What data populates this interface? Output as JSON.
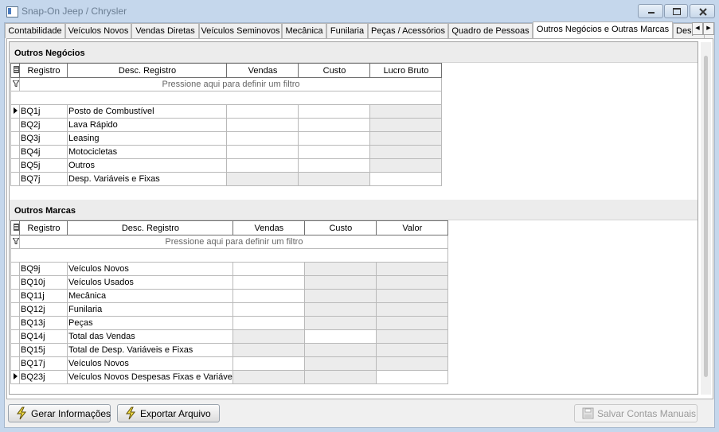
{
  "window": {
    "title": "Snap-On Jeep / Chrysler"
  },
  "tabs": [
    {
      "label": "Contabilidade"
    },
    {
      "label": "Veículos Novos"
    },
    {
      "label": "Vendas Diretas"
    },
    {
      "label": "Veículos Seminovos"
    },
    {
      "label": "Mecânica"
    },
    {
      "label": "Funilaria"
    },
    {
      "label": "Peças / Acessórios"
    },
    {
      "label": "Quadro de Pessoas"
    },
    {
      "label": "Outros Negócios e Outras Marcas",
      "active": true
    },
    {
      "label": "Desp"
    }
  ],
  "icons": {
    "tab_scroll_left": "chevron-left-icon",
    "tab_scroll_right": "chevron-right-icon",
    "row_indicator": "row-pointer-icon",
    "column_chooser": "column-chooser-icon",
    "filter": "funnel-icon",
    "action": "lightning-icon",
    "save": "save-icon"
  },
  "colors": {
    "title_text": "#6b7e93",
    "filter_hint": "#666666",
    "readonly_cell": "#ececec"
  },
  "section1": {
    "title": "Outros Negócios",
    "columns": [
      "Registro",
      "Desc. Registro",
      "Vendas",
      "Custo",
      "Lucro Bruto"
    ],
    "filter_hint": "Pressione aqui para definir um filtro",
    "rows": [
      {
        "registro": "BQ1j",
        "desc": "Posto de Combustível",
        "current": true
      },
      {
        "registro": "BQ2j",
        "desc": "Lava Rápido"
      },
      {
        "registro": "BQ3j",
        "desc": "Leasing"
      },
      {
        "registro": "BQ4j",
        "desc": "Motocicletas"
      },
      {
        "registro": "BQ5j",
        "desc": "Outros"
      },
      {
        "registro": "BQ7j",
        "desc": "Desp. Variáveis e Fixas"
      }
    ]
  },
  "section2": {
    "title": "Outros Marcas",
    "columns": [
      "Registro",
      "Desc. Registro",
      "Vendas",
      "Custo",
      "Valor"
    ],
    "filter_hint": "Pressione aqui para definir um filtro",
    "rows": [
      {
        "registro": "BQ9j",
        "desc": "Veículos Novos"
      },
      {
        "registro": "BQ10j",
        "desc": "Veículos Usados"
      },
      {
        "registro": "BQ11j",
        "desc": "Mecânica"
      },
      {
        "registro": "BQ12j",
        "desc": "Funilaria"
      },
      {
        "registro": "BQ13j",
        "desc": "Peças"
      },
      {
        "registro": "BQ14j",
        "desc": "Total das Vendas"
      },
      {
        "registro": "BQ15j",
        "desc": "Total de Desp. Variáveis e Fixas"
      },
      {
        "registro": "BQ17j",
        "desc": "Veículos Novos"
      },
      {
        "registro": "BQ23j",
        "desc": "Veículos Novos Despesas Fixas e Variáve",
        "current": true
      }
    ]
  },
  "buttons": {
    "gerar": "Gerar Informações",
    "exportar": "Exportar Arquivo",
    "salvar": "Salvar Contas Manuais"
  }
}
